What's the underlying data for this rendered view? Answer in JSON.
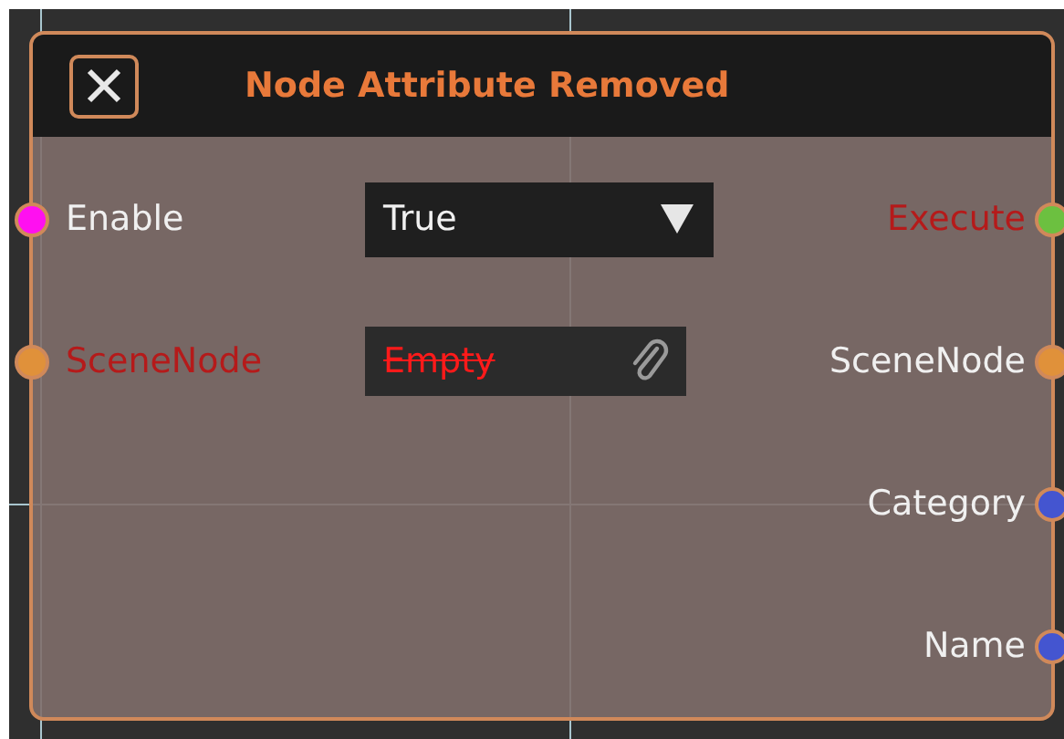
{
  "node": {
    "title": "Node Attribute Removed",
    "inputs": [
      {
        "label": "Enable",
        "color": "#ff10f0",
        "warning": false,
        "field": {
          "kind": "dropdown",
          "value": "True"
        }
      },
      {
        "label": "SceneNode",
        "color": "#e0913a",
        "warning": true,
        "field": {
          "kind": "object",
          "value": "Empty",
          "missing": true
        }
      }
    ],
    "outputs": [
      {
        "label": "Execute",
        "color": "#6cc040",
        "warning": true
      },
      {
        "label": "SceneNode",
        "color": "#e0913a",
        "warning": false
      },
      {
        "label": "Category",
        "color": "#4455d0",
        "warning": false
      },
      {
        "label": "Name",
        "color": "#4455d0",
        "warning": false
      }
    ]
  }
}
